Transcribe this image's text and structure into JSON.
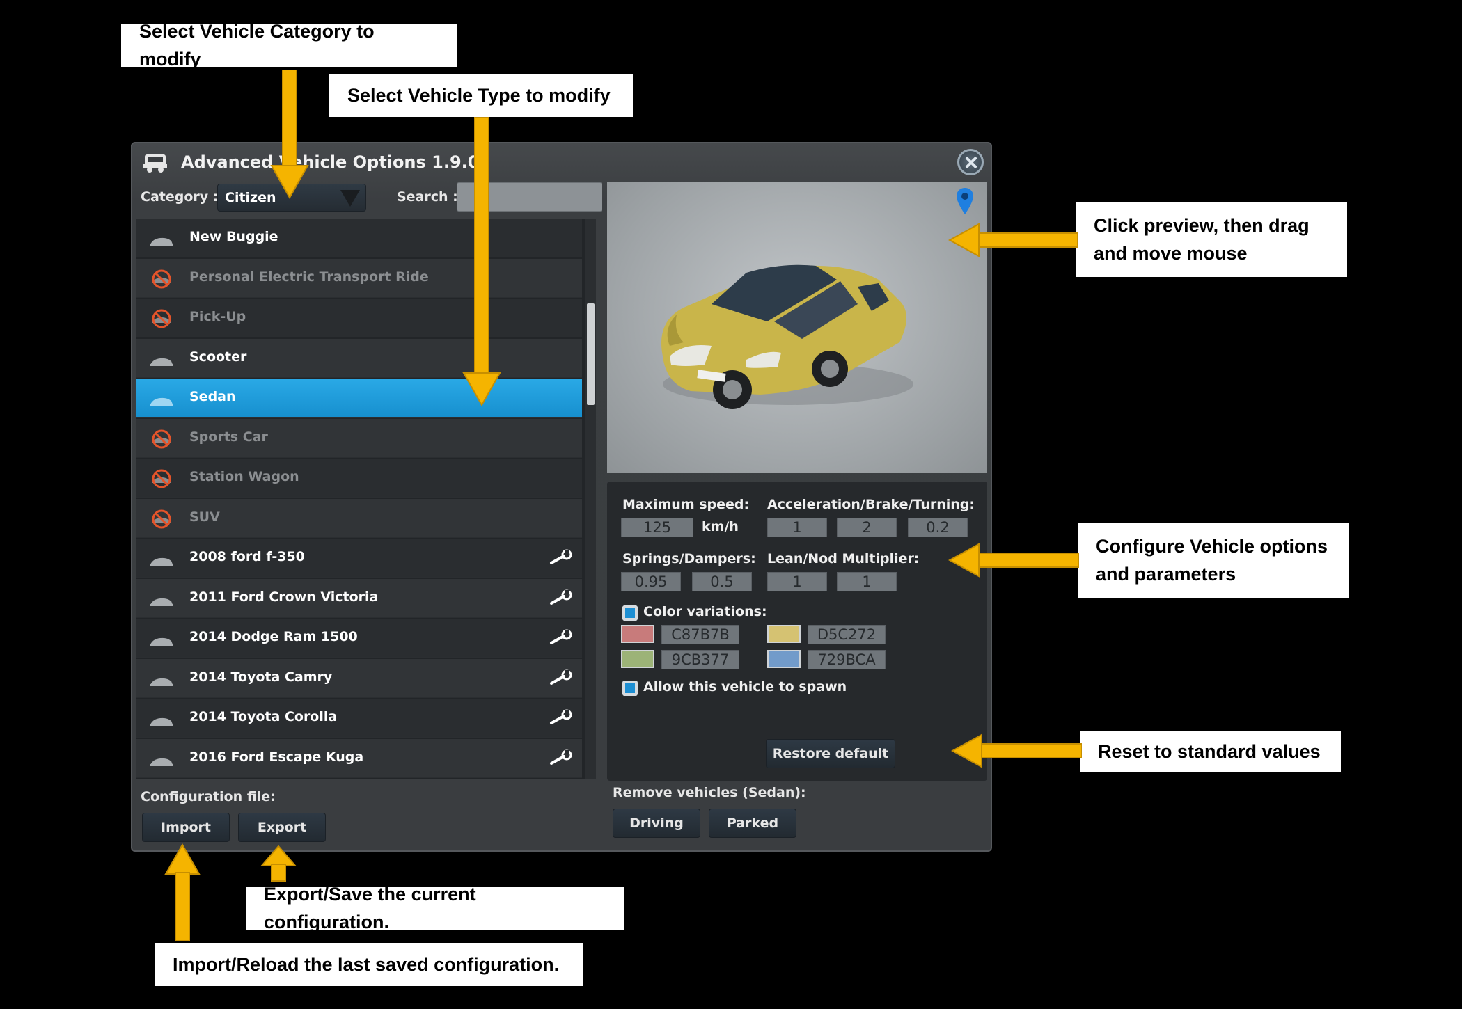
{
  "callouts": {
    "category": "Select Vehicle Category to modify",
    "type": "Select Vehicle Type to modify",
    "preview_line1": "Click preview, then drag",
    "preview_line2": "and move mouse",
    "options_line1": "Configure Vehicle options",
    "options_line2": "and parameters",
    "reset": "Reset to standard values",
    "export": "Export/Save the current configuration.",
    "import": "Import/Reload the last saved configuration."
  },
  "colors": {
    "arrow": "#f5b400",
    "selected_row": "#1c99d9",
    "window_bg": "#3b3e41"
  },
  "window": {
    "title": "Advanced Vehicle Options 1.9.0",
    "category_label": "Category :",
    "category_value": "Citizen",
    "search_label": "Search :",
    "search_value": ""
  },
  "vehicles": [
    {
      "name": "New Buggie",
      "state": "enabled",
      "icon": "car-icon",
      "custom": false
    },
    {
      "name": "Personal Electric Transport Ride",
      "state": "disabled",
      "icon": "disabled-car-icon",
      "custom": false
    },
    {
      "name": "Pick-Up",
      "state": "disabled",
      "icon": "disabled-car-icon",
      "custom": false
    },
    {
      "name": "Scooter",
      "state": "enabled",
      "icon": "car-icon",
      "custom": false
    },
    {
      "name": "Sedan",
      "state": "selected",
      "icon": "car-icon",
      "custom": false
    },
    {
      "name": "Sports Car",
      "state": "disabled",
      "icon": "disabled-car-icon",
      "custom": false
    },
    {
      "name": "Station Wagon",
      "state": "disabled",
      "icon": "disabled-car-icon",
      "custom": false
    },
    {
      "name": "SUV",
      "state": "disabled",
      "icon": "disabled-car-icon",
      "custom": false
    },
    {
      "name": "2008 ford f-350",
      "state": "enabled",
      "icon": "car-icon",
      "custom": true
    },
    {
      "name": "2011 Ford Crown Victoria",
      "state": "enabled",
      "icon": "car-icon",
      "custom": true
    },
    {
      "name": "2014 Dodge Ram 1500",
      "state": "enabled",
      "icon": "car-icon",
      "custom": true
    },
    {
      "name": "2014 Toyota Camry",
      "state": "enabled",
      "icon": "car-icon",
      "custom": true
    },
    {
      "name": "2014 Toyota Corolla",
      "state": "enabled",
      "icon": "car-icon",
      "custom": true
    },
    {
      "name": "2016 Ford Escape Kuga",
      "state": "enabled",
      "icon": "car-icon",
      "custom": true
    }
  ],
  "options": {
    "max_speed_label": "Maximum speed:",
    "max_speed_value": "125",
    "max_speed_unit": "km/h",
    "accel_label": "Acceleration/Brake/Turning:",
    "accel_values": [
      "1",
      "2",
      "0.2"
    ],
    "springs_label": "Springs/Dampers:",
    "springs_values": [
      "0.95",
      "0.5"
    ],
    "lean_label": "Lean/Nod Multiplier:",
    "lean_values": [
      "1",
      "1"
    ],
    "color_variations_label": "Color variations:",
    "color_variations_checked": true,
    "colors": [
      {
        "hex": "C87B7B",
        "swatch": "#c87b7b"
      },
      {
        "hex": "D5C272",
        "swatch": "#d5c272"
      },
      {
        "hex": "9CB377",
        "swatch": "#9cb377"
      },
      {
        "hex": "729BCA",
        "swatch": "#729bca"
      }
    ],
    "allow_spawn_label": "Allow this vehicle to spawn",
    "allow_spawn_checked": true,
    "restore_label": "Restore default"
  },
  "footer": {
    "config_label": "Configuration file:",
    "import_label": "Import",
    "export_label": "Export",
    "remove_label": "Remove vehicles (Sedan):",
    "driving_label": "Driving",
    "parked_label": "Parked"
  }
}
